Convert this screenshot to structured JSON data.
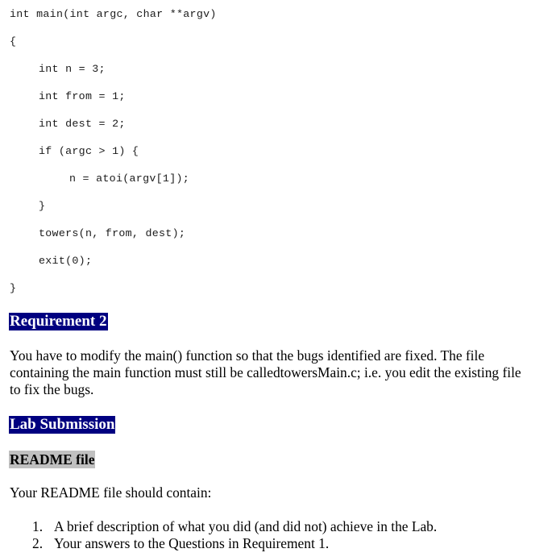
{
  "code": {
    "lines": [
      "int main(int argc, char **argv)",
      "{",
      "int n = 3;",
      "int from = 1;",
      "int dest = 2;",
      "if (argc > 1) {",
      "n = atoi(argv[1]);",
      "}",
      "towers(n, from, dest);",
      "exit(0);",
      "}"
    ]
  },
  "requirement2": {
    "heading": "Requirement 2",
    "paragraph_lines": [
      "You have to modify the main() function so that the bugs identified are fixed. The file",
      "containing the main function must still be calledtowersMain.c; i.e. you edit the existing file",
      "to fix the bugs."
    ]
  },
  "lab_submission": {
    "heading": "Lab Submission",
    "readme_heading": "README file",
    "intro": "Your README file should contain:",
    "list": [
      {
        "number": "1.",
        "text": "A brief description of what you did (and did not) achieve in the Lab."
      },
      {
        "number": "2.",
        "text": "Your answers to the Questions in Requirement 1."
      }
    ]
  }
}
